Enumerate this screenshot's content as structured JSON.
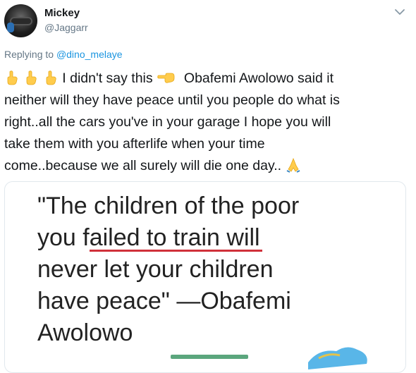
{
  "tweet": {
    "display_name": "Mickey",
    "handle": "@Jaggarr",
    "reply_prefix": "Replying to",
    "reply_mention": "@dino_melaye",
    "body_lines": {
      "l1_text": "I didn't say this",
      "l1_after": "Obafemi Awolowo said it",
      "l2": "neither will they have peace until you people do what is",
      "l3": "right..all the cars you've in your garage I hope you will",
      "l4": "take them with you afterlife when your time",
      "l5": "come..because we all surely will die one day.."
    },
    "emojis": [
      "pointing-up-icon",
      "pointing-up-icon",
      "pointing-up-icon",
      "pointing-left-icon",
      "folded-hands-icon"
    ],
    "quote_image": {
      "line1": "\"The children of the poor",
      "line2_pre": "you ",
      "line2_underlined": "failed to train",
      "line2_post": " will",
      "line3": "never let your children",
      "line4": "have peace\" —Obafemi",
      "line5": "Awolowo"
    },
    "colors": {
      "mention": "#1b95e0",
      "muted": "#657786",
      "underline": "#d0313a"
    }
  }
}
